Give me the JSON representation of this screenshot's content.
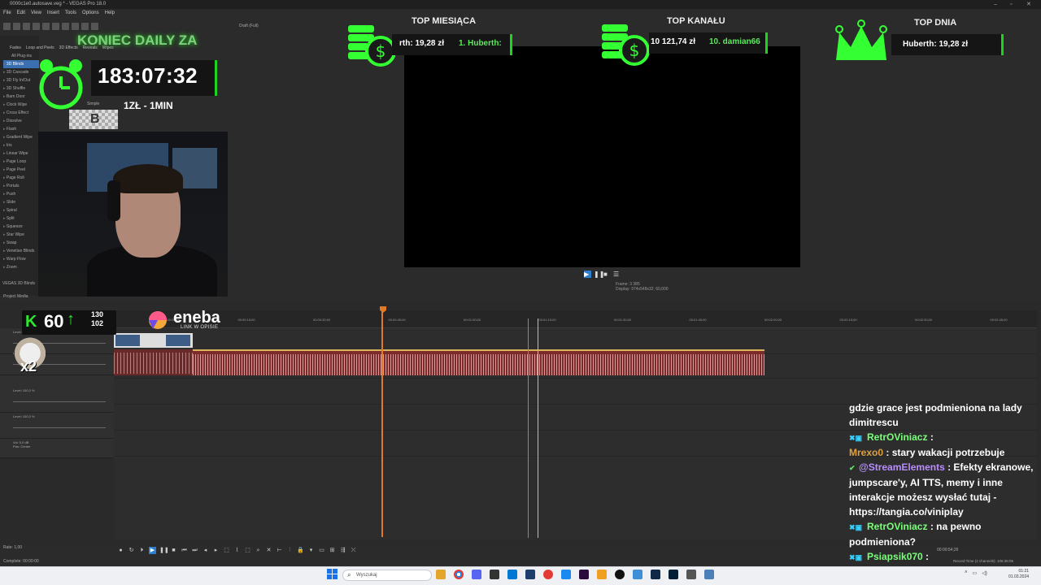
{
  "window": {
    "title": "0000c1e0.autosave.veg * - VEGAS Pro 18.0",
    "menu": [
      "File",
      "Edit",
      "View",
      "Insert",
      "Tools",
      "Options",
      "Help"
    ]
  },
  "toolbar": {
    "preview_mode": "Draft (Full)"
  },
  "plugins": {
    "tabs": [
      "Fades",
      "Loop and Peels",
      "3D Effects",
      "Reveals",
      "Wipes"
    ],
    "all_label": "All Plug-ins",
    "items": [
      "3D Blinds",
      "3D Cascade",
      "3D Fly In/Out",
      "3D Shuffle",
      "Barn Door",
      "Clock Wipe",
      "Cross Effect",
      "Dissolve",
      "Flash",
      "Gradient Wipe",
      "Iris",
      "Linear Wipe",
      "Page Loop",
      "Page Peel",
      "Page Roll",
      "Portals",
      "Push",
      "Slide",
      "Spiral",
      "Split",
      "Squeeze",
      "Star Wipe",
      "Swap",
      "Venetian Blinds",
      "Warp Flow",
      "Zoom"
    ],
    "selected": "3D Blinds",
    "footer": "VEGAS 3D Blinds",
    "thumb_label": "Simple"
  },
  "project_media_label": "Project Media",
  "subathon": {
    "title": "KONIEC DAILY ZA",
    "timer": "183:07:32",
    "rate": "1ZŁ - 1MIN"
  },
  "tops": [
    {
      "title": "TOP MIESIĄCA",
      "text_left": "rth: 19,28 zł",
      "text_right": "1. Huberth:"
    },
    {
      "title": "TOP KANAŁU",
      "text_left": "10 121,74 zł",
      "text_right": "10. damian66"
    },
    {
      "title": "TOP DNIA",
      "text_left": "Huberth: 19,28 zł",
      "text_right": ""
    }
  ],
  "preview": {
    "frame_label": "Frame:",
    "frame_value": "3 385",
    "display_label": "Display:",
    "display_value": "974x548x32; 60,000"
  },
  "kick": {
    "viewers": "60",
    "stat_top": "130",
    "stat_bottom": "102"
  },
  "eneba": {
    "name": "eneba",
    "sub": "LINK W OPISIE"
  },
  "cat_multiplier": "x2",
  "tracks": [
    {
      "label": "Level: 100,0 %"
    },
    {
      "label": "Level: 100,0 %"
    },
    {
      "label": "Level: 100,0 %"
    },
    {
      "label": "Level: 100,0 %"
    },
    {
      "vol": "Vol: 0,0 dB",
      "pan": "Pan: Center"
    }
  ],
  "ruler_marks": [
    "00:00:00;00",
    "00:00:15;00",
    "00:00:30;00",
    "00:00:45;00",
    "00:01:00;00",
    "00:01:15;00",
    "00:01:30;00",
    "00:01:45;00",
    "00:02:00;00",
    "00:02:15;00",
    "00:02:30;00",
    "00:02:45;00",
    "00:03:00;00"
  ],
  "status": {
    "rate": "Rate: 1,00",
    "complete": "Complete: 00:00:00",
    "record_time": "Record Time (2 channels): 106:35:05",
    "position": "00:00:54;26"
  },
  "chat": [
    {
      "nick": "",
      "text": "gdzie grace jest podmieniona na lady dimitrescu",
      "color": ""
    },
    {
      "nick": "RetrOViniacz",
      "text": " :",
      "color": "a"
    },
    {
      "nick": "Mrexo0",
      "text": " : stary wakacji potrzebuje",
      "color": "b"
    },
    {
      "nick": "@StreamElements",
      "text": " : Efekty ekranowe, jumpscare'y, AI TTS, memy i inne interakcje możesz wysłać tutaj - https://tangia.co/viniplay",
      "color": "c"
    },
    {
      "nick": "RetrOViniacz",
      "text": " : na pewno podmieniona?",
      "color": "a"
    },
    {
      "nick": "Psiapsik070",
      "text": " :",
      "color": "a"
    },
    {
      "nick": "Psiapsik070",
      "text": "",
      "color": "a"
    }
  ],
  "taskbar": {
    "search_placeholder": "Wyszukaj",
    "time": "01:21",
    "date": "01.03.2024"
  }
}
